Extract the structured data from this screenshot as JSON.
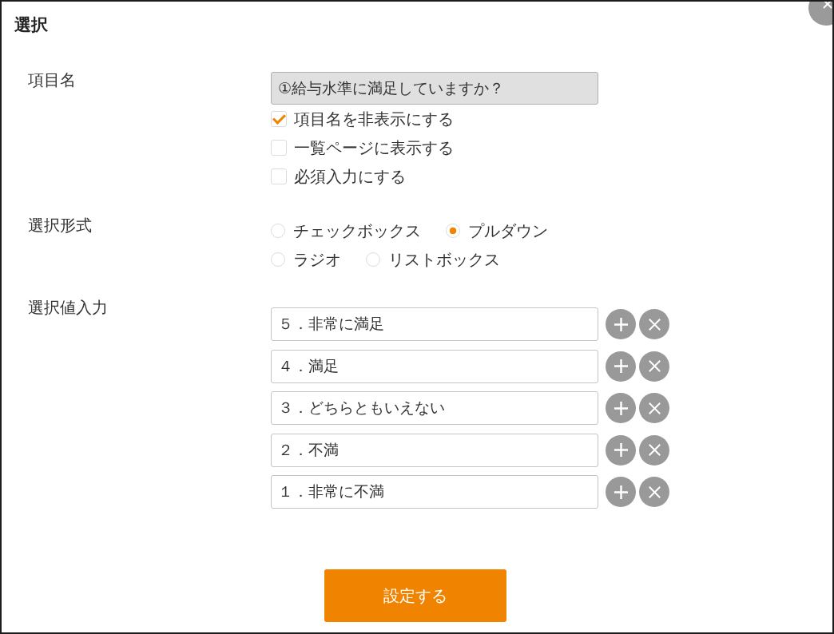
{
  "dialog": {
    "title": "選択"
  },
  "item_name": {
    "label": "項目名",
    "field": {
      "value": "①給与水準に満足していますか？",
      "disabled": true
    },
    "checkboxes": [
      {
        "label": "項目名を非表示にする",
        "checked": true
      },
      {
        "label": "一覧ページに表示する",
        "checked": false
      },
      {
        "label": "必須入力にする",
        "checked": false
      }
    ]
  },
  "selection_format": {
    "label": "選択形式",
    "options": [
      {
        "label": "チェックボックス",
        "selected": false
      },
      {
        "label": "プルダウン",
        "selected": true
      },
      {
        "label": "ラジオ",
        "selected": false
      },
      {
        "label": "リストボックス",
        "selected": false
      }
    ]
  },
  "choice_values": {
    "label": "選択値入力",
    "items": [
      {
        "value": "５．非常に満足"
      },
      {
        "value": "４．満足"
      },
      {
        "value": "３．どちらともいえない"
      },
      {
        "value": "２．不満"
      },
      {
        "value": "１．非常に不満"
      }
    ]
  },
  "submit_button": {
    "label": "設定する"
  }
}
